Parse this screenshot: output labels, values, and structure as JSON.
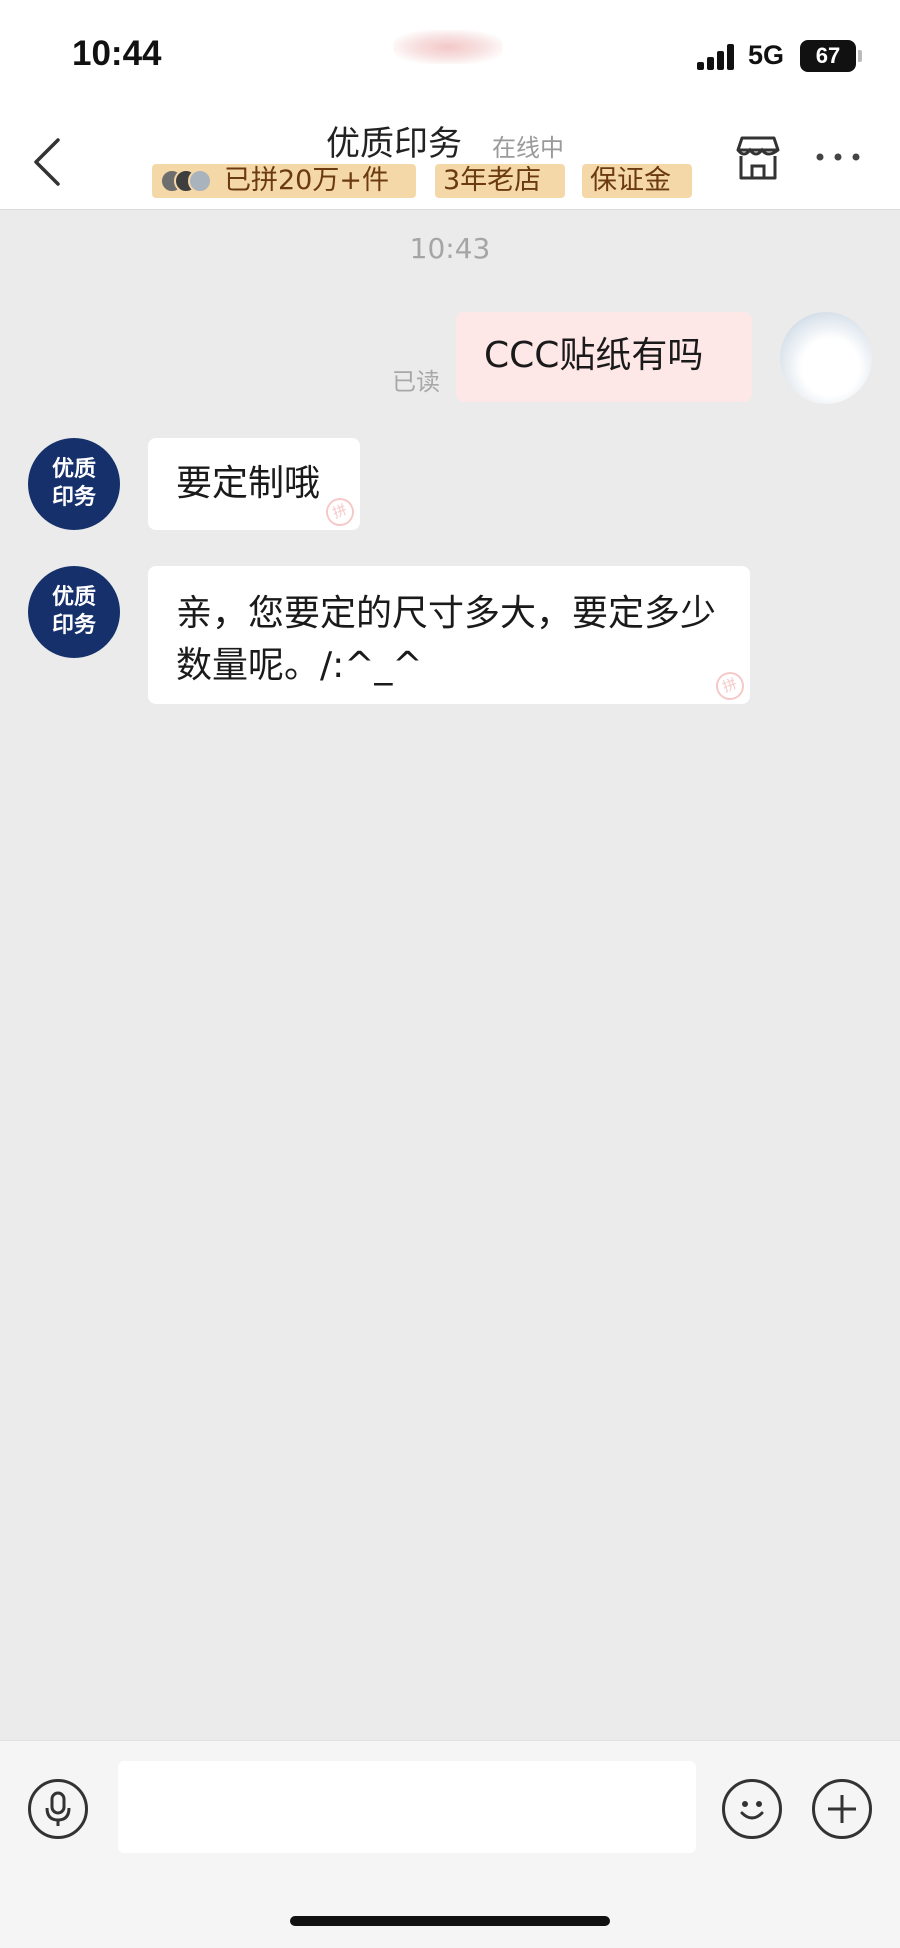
{
  "status_bar": {
    "time": "10:44",
    "network": "5G",
    "battery": "67"
  },
  "header": {
    "title": "优质印务",
    "online_status": "在线中",
    "badges": [
      "已拼20万+件",
      "3年老店",
      "保证金"
    ]
  },
  "chat": {
    "timestamp": "10:43",
    "messages": [
      {
        "sender": "me",
        "text": "CCC贴纸有吗",
        "status": "已读"
      },
      {
        "sender": "shop",
        "avatar_text": "优质\n印务",
        "text": "要定制哦"
      },
      {
        "sender": "shop",
        "avatar_text": "优质\n印务",
        "text": "亲，您要定的尺寸多大，要定多少数量呢。/:^_^"
      }
    ]
  },
  "input_bar": {
    "message_value": "",
    "icons": [
      "microphone-icon",
      "emoji-icon",
      "plus-icon"
    ]
  },
  "colors": {
    "chat_background": "#ebebeb",
    "my_bubble": "#fde7e7",
    "their_bubble": "#ffffff",
    "badge_background": "#f5d8a8",
    "shop_avatar": "#15306b"
  }
}
